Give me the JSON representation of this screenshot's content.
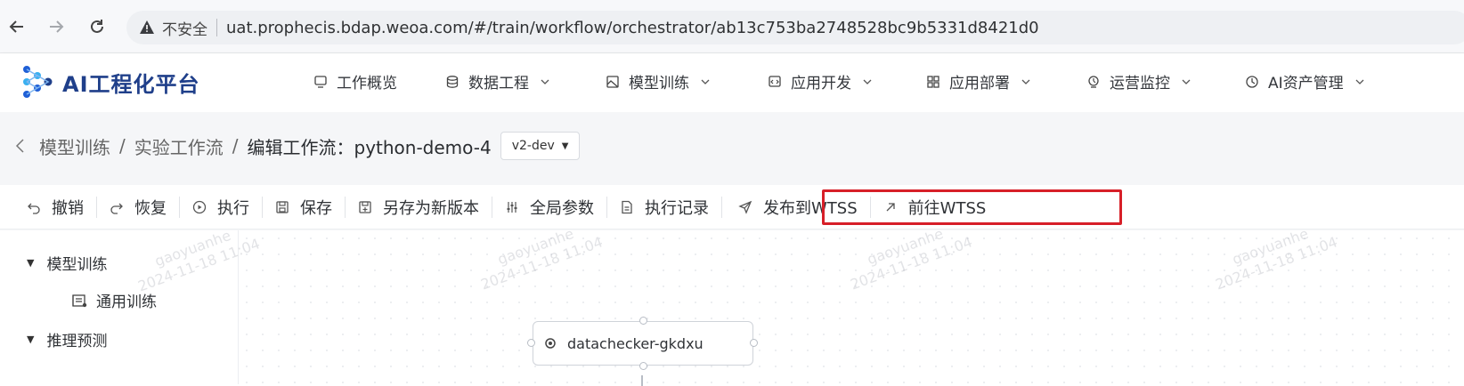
{
  "browser": {
    "insecure_label": "不安全",
    "url": "uat.prophecis.bdap.weoa.com/#/train/workflow/orchestrator/ab13c753ba2748528bc9b5331d8421d0"
  },
  "app": {
    "title": "AI工程化平台",
    "brand_color": "#1f3f8a"
  },
  "menu": [
    {
      "label": "工作概览",
      "icon": "monitor-icon",
      "has_dropdown": false
    },
    {
      "label": "数据工程",
      "icon": "database-icon",
      "has_dropdown": true
    },
    {
      "label": "模型训练",
      "icon": "image-icon",
      "has_dropdown": true
    },
    {
      "label": "应用开发",
      "icon": "code-icon",
      "has_dropdown": true
    },
    {
      "label": "应用部署",
      "icon": "deploy-icon",
      "has_dropdown": true
    },
    {
      "label": "运营监控",
      "icon": "monitor-pin-icon",
      "has_dropdown": true
    },
    {
      "label": "AI资产管理",
      "icon": "clock-icon",
      "has_dropdown": true
    }
  ],
  "breadcrumb": {
    "items": [
      "模型训练",
      "实验工作流"
    ],
    "current": "编辑工作流：python-demo-4",
    "version": "v2-dev"
  },
  "toolbar": {
    "items": [
      {
        "label": "撤销",
        "icon": "undo-icon"
      },
      {
        "label": "恢复",
        "icon": "redo-icon"
      },
      {
        "label": "执行",
        "icon": "play-icon"
      },
      {
        "label": "保存",
        "icon": "save-icon"
      },
      {
        "label": "另存为新版本",
        "icon": "save-as-icon"
      },
      {
        "label": "全局参数",
        "icon": "sliders-icon"
      },
      {
        "label": "执行记录",
        "icon": "document-icon"
      },
      {
        "label": "发布到WTSS",
        "icon": "send-icon"
      },
      {
        "label": "前往WTSS",
        "icon": "arrow-up-right-icon"
      }
    ],
    "highlight_color": "#d71f28"
  },
  "sidebar": {
    "groups": [
      {
        "label": "模型训练",
        "children": [
          {
            "label": "通用训练",
            "icon": "train-icon"
          }
        ]
      },
      {
        "label": "推理预测",
        "children": []
      }
    ]
  },
  "canvas": {
    "node": {
      "label": "datachecker-gkdxu",
      "icon": "gear-icon"
    }
  },
  "watermark": {
    "user": "gaoyuanhe",
    "time": "2024-11-18 11:04"
  }
}
